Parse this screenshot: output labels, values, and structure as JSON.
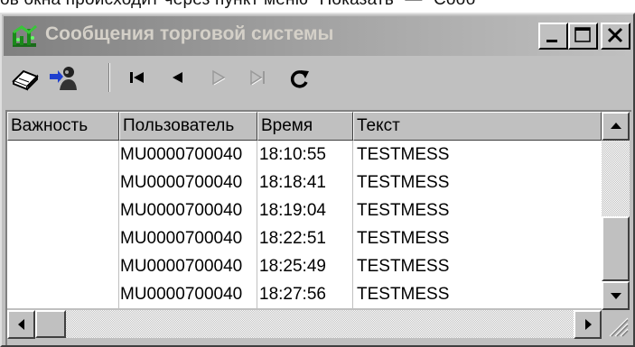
{
  "document_text": "ов окна происходит через пункт меню \"Показать\" — \"Сооб",
  "window": {
    "title": "Сообщения торговой системы",
    "icons": {
      "app": "traffic-app-icon",
      "minimize": "minimize-icon",
      "maximize": "maximize-icon",
      "close": "close-icon"
    }
  },
  "toolbar": {
    "items": [
      {
        "name": "book-icon",
        "enabled": true
      },
      {
        "name": "user-arrow-icon",
        "enabled": true
      },
      {
        "name": "first-icon",
        "enabled": true
      },
      {
        "name": "previous-icon",
        "enabled": true
      },
      {
        "name": "next-icon",
        "enabled": false
      },
      {
        "name": "last-icon",
        "enabled": false
      },
      {
        "name": "refresh-icon",
        "enabled": true
      }
    ]
  },
  "table": {
    "columns": [
      "Важность",
      "Пользователь",
      "Время",
      "Текст"
    ],
    "rows": [
      [
        "",
        "MU0000700040",
        "18:10:55",
        "TESTMESS"
      ],
      [
        "",
        "MU0000700040",
        "18:18:41",
        "TESTMESS"
      ],
      [
        "",
        "MU0000700040",
        "18:19:04",
        "TESTMESS"
      ],
      [
        "",
        "MU0000700040",
        "18:22:51",
        "TESTMESS"
      ],
      [
        "",
        "MU0000700040",
        "18:25:49",
        "TESTMESS"
      ],
      [
        "",
        "MU0000700040",
        "18:27:56",
        "TESTMESS"
      ]
    ]
  },
  "scrollbars": {
    "vertical_position": 1.0,
    "horizontal_position": 0.0
  }
}
